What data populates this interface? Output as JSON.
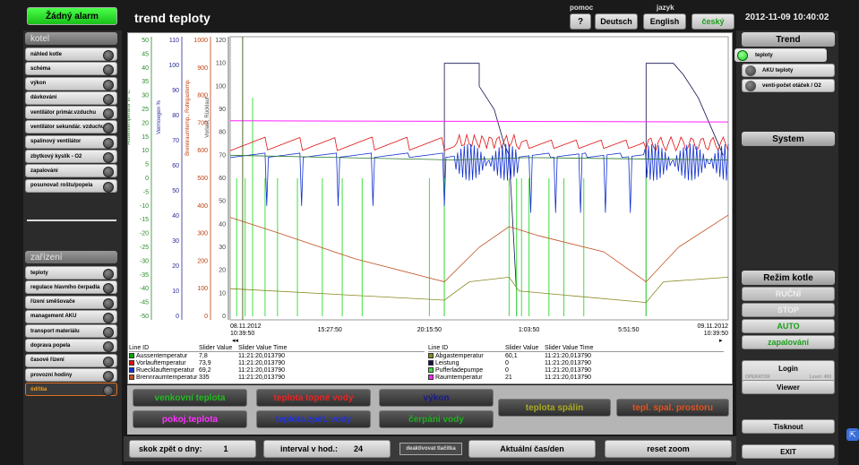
{
  "alarm_label": "Žádný alarm",
  "page_title": "trend teploty",
  "header": {
    "help_label": "pomoc",
    "help_button": "?",
    "language_label": "jazyk",
    "languages": [
      "Deutsch",
      "English",
      "český"
    ],
    "datetime": "2012-11-09 10:40:02"
  },
  "left": {
    "kotel_title": "kotel",
    "kotel_items": [
      "náhled kotle",
      "schéma",
      "výkon",
      "dávkování",
      "ventilátor primár.vzduchu",
      "ventilátor sekundár. vzduchu",
      "spalinový ventilátor",
      "zbytkový kyslík - O2",
      "zapalování",
      "posunovač roštu/popela"
    ],
    "zarizeni_title": "zařízení",
    "zarizeni_items": [
      "teploty",
      "regulace hlavního čerpadla",
      "řízení směšovače",
      "management AKU",
      "transport materiálu",
      "doprava popela",
      "časové řízení",
      "provozní hodiny",
      "ódřiba"
    ]
  },
  "right": {
    "trend_title": "Trend",
    "trend_items": [
      "teploty",
      "AKU teploty",
      "venti-počet otáček / O2"
    ],
    "system_title": "System",
    "mode_title": "Režim kotle",
    "modes": [
      "RUČNÍ",
      "STOP",
      "AUTO",
      "zapalování"
    ],
    "login_label": "Login",
    "operator_label": "OPERATOR",
    "level_label": "Level: 400",
    "viewer_label": "Viewer",
    "print_label": "Tisknout",
    "exit_label": "EXIT"
  },
  "chart_data": {
    "type": "line",
    "axes": [
      {
        "label": "Außentemperatur in °C",
        "ticks": [
          "50",
          "45",
          "40",
          "35",
          "30",
          "25",
          "20",
          "15",
          "10",
          "5",
          "0",
          "-5",
          "-10",
          "-15",
          "-20",
          "-25",
          "-30",
          "-35",
          "-40",
          "-45",
          "-50"
        ],
        "color": "#2a8a2a"
      },
      {
        "label": "Vermoegen %",
        "ticks": [
          "110",
          "100",
          "90",
          "80",
          "70",
          "60",
          "50",
          "40",
          "30",
          "20",
          "10",
          "0"
        ],
        "color": "#2a2a9a"
      },
      {
        "label": "Brennraumtemp., Rohrgastemp.",
        "ticks": [
          "1000",
          "900",
          "800",
          "700",
          "600",
          "500",
          "400",
          "300",
          "200",
          "100",
          "0"
        ],
        "color": "#c04010"
      },
      {
        "label": "Vorlauf, Rücklauf",
        "ticks": [
          "120",
          "110",
          "100",
          "90",
          "80",
          "70",
          "60",
          "50",
          "40",
          "30",
          "20",
          "10",
          "0"
        ],
        "color": "#444"
      }
    ],
    "x_ticks": [
      {
        "date": "08.11.2012",
        "time": "10:39:50"
      },
      {
        "date": "",
        "time": "15:27:50"
      },
      {
        "date": "",
        "time": "20:15:50"
      },
      {
        "date": "",
        "time": "1:03:50"
      },
      {
        "date": "",
        "time": "5:51:50"
      },
      {
        "date": "09.11.2012",
        "time": "10:39:50"
      }
    ],
    "series": [
      {
        "name": "Aussentemperatur",
        "color": "#00aa00",
        "value": "7,8",
        "time": "11:21:20,013790"
      },
      {
        "name": "Vorlauftemperatur",
        "color": "#e01010",
        "value": "73,9",
        "time": "11:21:20,013790"
      },
      {
        "name": "Ruecklauftemperatur",
        "color": "#1030d0",
        "value": "69,2",
        "time": "11:21:20,013790"
      },
      {
        "name": "Brennraumtemperatur",
        "color": "#c05020",
        "value": "335",
        "time": "11:21:20,013790"
      },
      {
        "name": "Abgastemperatur",
        "color": "#888820",
        "value": "60,1",
        "time": "11:21:20,013790"
      },
      {
        "name": "Leistung",
        "color": "#101050",
        "value": "0",
        "time": "11:21:20,013790"
      },
      {
        "name": "Pufferladepumpe",
        "color": "#40e040",
        "value": "0",
        "time": "11:21:20,013790"
      },
      {
        "name": "Raumtemperatur",
        "color": "#ff20ff",
        "value": "21",
        "time": "11:21:20,013790"
      }
    ],
    "legend_headers": [
      "Line ID",
      "Slider Value",
      "Slider Value Time"
    ]
  },
  "series_buttons": [
    {
      "label": "venkovní teplota",
      "color": "#22bb22"
    },
    {
      "label": "teplota topné vody",
      "color": "#ee2222"
    },
    {
      "label": "výkon",
      "color": "#1a1a8a"
    },
    {
      "label": "pokoj.teplota",
      "color": "#ff33ff"
    },
    {
      "label": "teplota zpět. vody",
      "color": "#2233dd"
    },
    {
      "label": "čerpání vody",
      "color": "#22aa22"
    },
    {
      "label": "teplota spálin",
      "color": "#aaaa22"
    },
    {
      "label": "tepl. spal. prostoru",
      "color": "#dd5522"
    }
  ],
  "bottom": {
    "back_days_label": "skok zpět o dny:",
    "back_days_value": "1",
    "interval_label": "interval v hod.:",
    "interval_value": "24",
    "deactivate_label": "deaktivovat tlačítka",
    "current_label": "Aktuální čas/den",
    "reset_label": "reset zoom"
  }
}
